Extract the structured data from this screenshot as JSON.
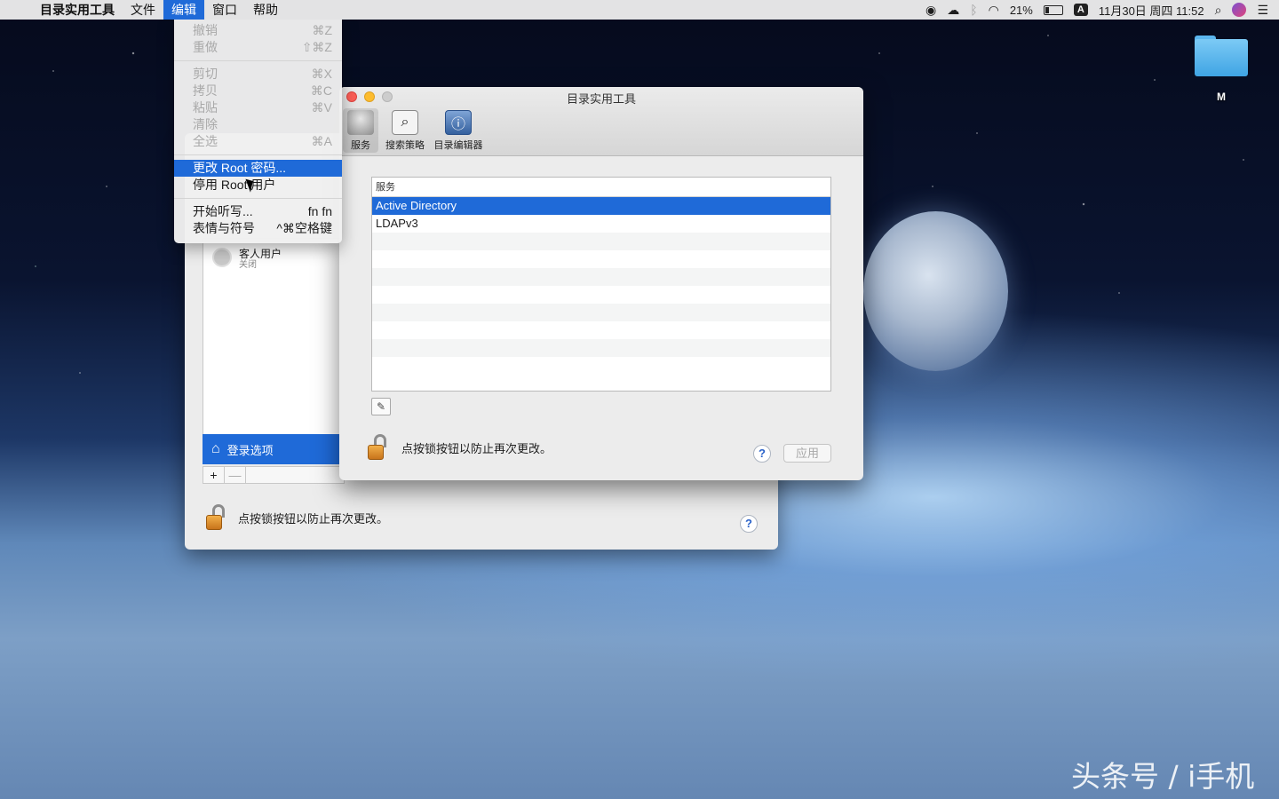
{
  "menubar": {
    "apple_icon": "apple-icon",
    "items": [
      {
        "label": "目录实用工具"
      },
      {
        "label": "文件"
      },
      {
        "label": "编辑"
      },
      {
        "label": "窗口"
      },
      {
        "label": "帮助"
      }
    ],
    "battery": "21%",
    "input_source": "A",
    "datetime": "11月30日 周四 11:52"
  },
  "edit_menu": {
    "undo": {
      "label": "撤销",
      "shortcut": "⌘Z"
    },
    "redo": {
      "label": "重做",
      "shortcut": "⇧⌘Z"
    },
    "cut": {
      "label": "剪切",
      "shortcut": "⌘X"
    },
    "copy": {
      "label": "拷贝",
      "shortcut": "⌘C"
    },
    "paste": {
      "label": "粘贴",
      "shortcut": "⌘V"
    },
    "clear": {
      "label": "清除",
      "shortcut": ""
    },
    "select_all": {
      "label": "全选",
      "shortcut": "⌘A"
    },
    "change_root": {
      "label": "更改 Root 密码..."
    },
    "disable_root": {
      "label": "停用 Root 用户"
    },
    "dictation": {
      "label": "开始听写...",
      "shortcut": "fn fn"
    },
    "emoji": {
      "label": "表情与符号",
      "shortcut": "^⌘空格键"
    }
  },
  "back_window": {
    "guest_name": "客人用户",
    "guest_status": "关闭",
    "login_options": "登录选项",
    "plus": "+",
    "minus": "—",
    "lock_text": "点按锁按钮以防止再次更改。",
    "help": "?"
  },
  "window": {
    "title": "目录实用工具",
    "toolbar": [
      {
        "label": "服务"
      },
      {
        "label": "搜索策略"
      },
      {
        "label": "目录编辑器"
      }
    ],
    "table_header": "服务",
    "services": [
      "Active Directory",
      "LDAPv3"
    ],
    "lock_text": "点按锁按钮以防止再次更改。",
    "help": "?",
    "apply": "应用"
  },
  "desktop": {
    "folder_label": "M"
  },
  "watermark": "头条号 / i手机"
}
